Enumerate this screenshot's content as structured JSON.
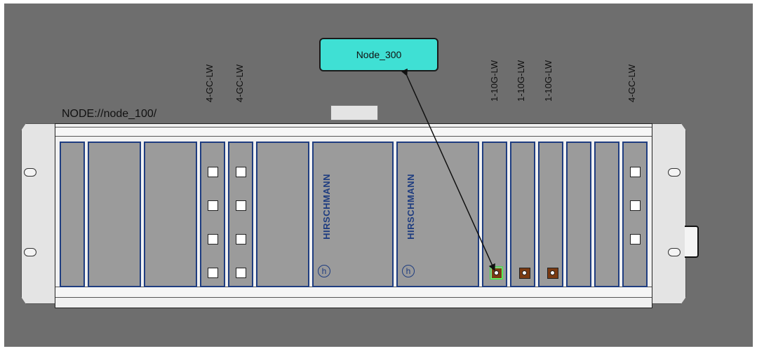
{
  "node300": {
    "label": "Node_300"
  },
  "node100": {
    "path": "NODE://node_100/"
  },
  "module_labels": [
    {
      "text": "4-GC-LW"
    },
    {
      "text": "4-GC-LW"
    },
    {
      "text": "1-10G-LW"
    },
    {
      "text": "1-10G-LW"
    },
    {
      "text": "1-10G-LW"
    },
    {
      "text": "4-GC-LW"
    }
  ],
  "brand": {
    "text": "HIRSCHMANN",
    "logo": "h"
  },
  "colors": {
    "background": "#6e6e6e",
    "node_box": "#3fe0d4",
    "slot": "#9b9b9b",
    "slot_border": "#1f3d80",
    "optical_port": "#7a3a12",
    "active_port": "#45e04b"
  },
  "icons": {
    "ear_hole": "ear-mount-hole-icon",
    "copper_port": "rj45-port-icon",
    "optical_port": "sfp-port-icon",
    "logo": "hirschmann-logo-icon"
  },
  "link": {
    "from": "Node_300",
    "to": "1-10G-LW"
  }
}
